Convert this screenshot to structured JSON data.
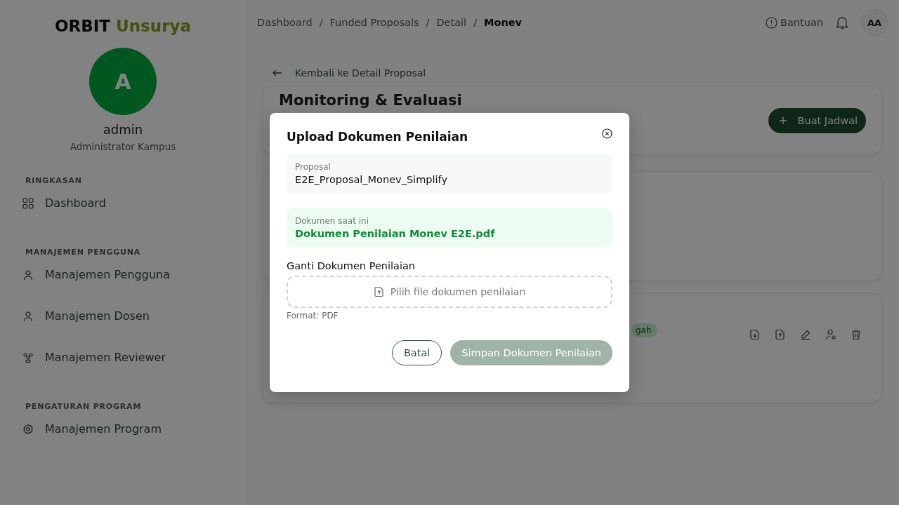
{
  "brand": {
    "name": "ORBIT",
    "accent": "Unsurya"
  },
  "user": {
    "initial": "A",
    "name": "admin",
    "role": "Administrator Kampus"
  },
  "sidebar": {
    "sections": [
      {
        "title": "RINGKASAN",
        "items": [
          {
            "label": "Dashboard",
            "kind": "grid"
          }
        ]
      },
      {
        "title": "MANAJEMEN PENGGUNA",
        "items": [
          {
            "label": "Manajemen Pengguna",
            "kind": "user"
          },
          {
            "label": "Manajemen Dosen",
            "kind": "user"
          },
          {
            "label": "Manajemen Reviewer",
            "kind": "group"
          }
        ]
      },
      {
        "title": "PENGATURAN PROGRAM",
        "items": [
          {
            "label": "Manajemen Program",
            "kind": "gear"
          }
        ]
      }
    ]
  },
  "breadcrumb": [
    {
      "label": "Dashboard"
    },
    {
      "separator": "/",
      "label": "Funded Proposals"
    },
    {
      "separator": "/",
      "label": "Detail"
    },
    {
      "separator": "/",
      "label": "Monev"
    }
  ],
  "topbar": {
    "help": "Bantuan",
    "avatar": "AA"
  },
  "back_link": "Kembali ke Detail Proposal",
  "page_title": "Monitoring & Evaluasi",
  "create_button": "Buat Jadwal",
  "row": {
    "badge": "gah"
  },
  "modal": {
    "title": "Upload Dokumen Penilaian",
    "proposal": {
      "label": "Proposal",
      "value": "E2E_Proposal_Monev_Simplify"
    },
    "current": {
      "label": "Dokumen saat ini",
      "value": "Dokumen Penilaian Monev E2E.pdf"
    },
    "replace_label": "Ganti Dokumen Penilaian",
    "dropzone": "Pilih file dokumen penilaian",
    "hint": "Format: PDF",
    "cancel": "Batal",
    "submit": {
      "label": "Simpan Dokumen Penilaian",
      "disabled": true
    }
  }
}
